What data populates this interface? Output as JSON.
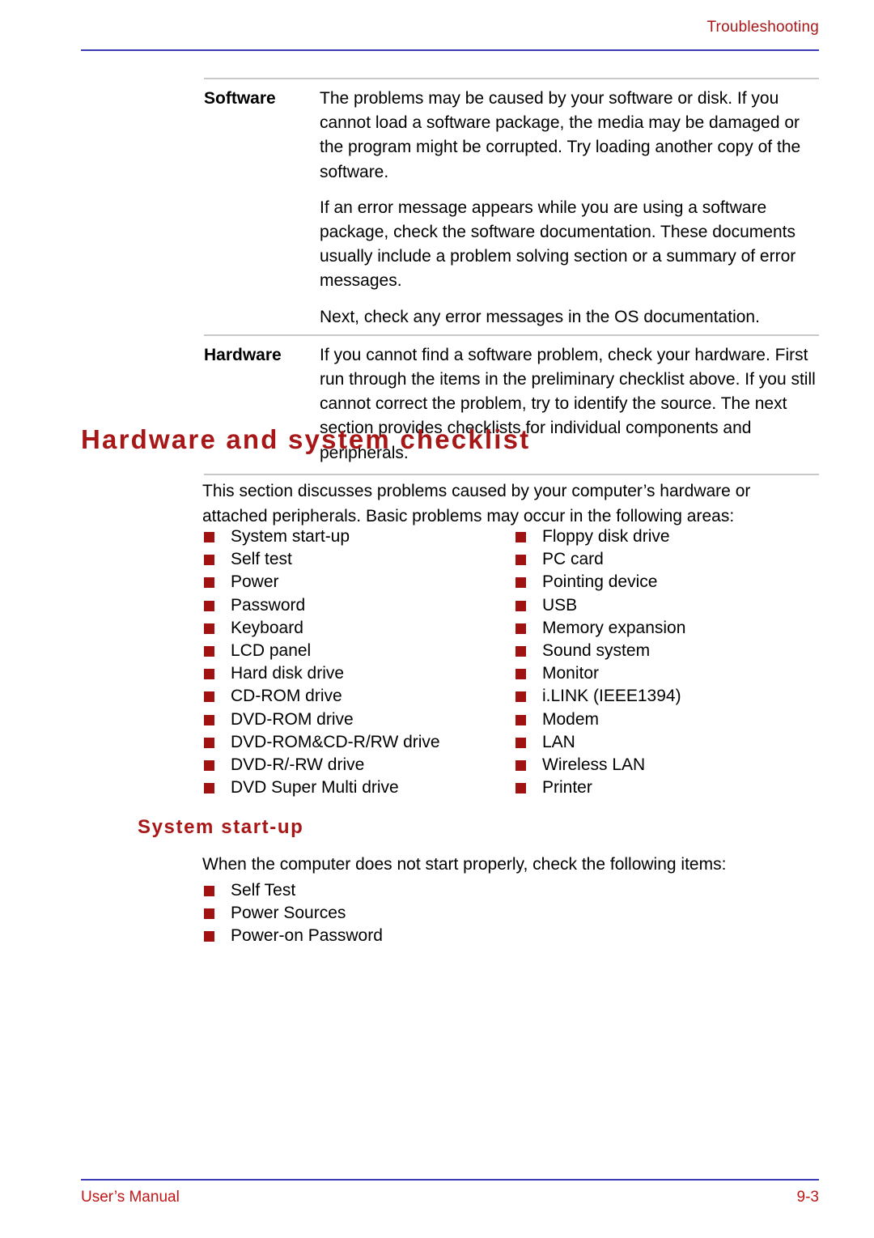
{
  "header": {
    "chapter": "Troubleshooting",
    "rule_color": "#3a3ab4"
  },
  "deftable": {
    "rows": [
      {
        "term": "Software",
        "paragraphs": [
          "The problems may be caused by your software or disk. If you cannot load a software package, the media may be damaged or the program might be corrupted. Try loading another copy of the software.",
          "If an error message appears while you are using a software package, check the software documentation. These documents usually include a problem solving section or a summary of error messages.",
          "Next, check any error messages in the OS documentation."
        ]
      },
      {
        "term": "Hardware",
        "paragraphs": [
          "If you cannot find a software problem, check your hardware. First run through the items in the preliminary checklist above. If you still cannot correct the problem, try to identify the source. The next section provides checklists for individual components and peripherals."
        ]
      }
    ]
  },
  "section": {
    "title": "Hardware and system checklist",
    "title_color": "#a81717",
    "intro": "This section discusses problems caused by your computer’s hardware or attached peripherals. Basic problems may occur in the following areas:",
    "checklist_left": [
      "System start-up",
      "Self test",
      "Power",
      "Password",
      "Keyboard",
      "LCD panel",
      "Hard disk drive",
      "CD-ROM drive",
      "DVD-ROM drive",
      "DVD-ROM&CD-R/RW drive",
      "DVD-R/-RW drive",
      "DVD Super Multi drive"
    ],
    "checklist_right": [
      "Floppy disk drive",
      "PC card",
      "Pointing device",
      "USB",
      "Memory expansion",
      "Sound system",
      "Monitor",
      "i.LINK (IEEE1394)",
      "Modem",
      "LAN",
      "Wireless LAN",
      "Printer"
    ],
    "bullet_color": "#a01212"
  },
  "subsection": {
    "title": "System start-up",
    "intro": "When the computer does not start properly, check the following items:",
    "items": [
      "Self Test",
      "Power Sources",
      "Power-on Password"
    ]
  },
  "footer": {
    "left": "User’s Manual",
    "right": "9-3",
    "text_color": "#c01616",
    "rule_color": "#3a3ab4"
  }
}
